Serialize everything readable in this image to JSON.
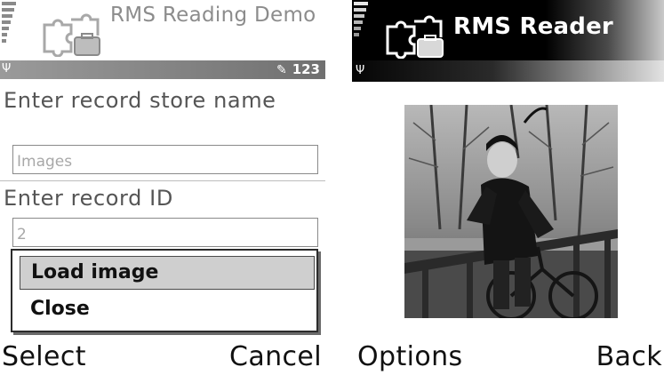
{
  "left_screen": {
    "title": "RMS Reading Demo",
    "status_mode": "123",
    "form": {
      "store_label": "Enter record store name",
      "store_value": "Images",
      "id_label": "Enter record ID",
      "id_value": "2"
    },
    "menu": {
      "items": [
        "Load image",
        "Close"
      ],
      "selected_index": 0
    },
    "softkeys": {
      "left": "Select",
      "right": "Cancel"
    }
  },
  "right_screen": {
    "title": "RMS Reader",
    "softkeys": {
      "left": "Options",
      "right": "Back"
    }
  },
  "icons": [
    "signal-strength-icon",
    "app-puzzle-icon",
    "antenna-icon",
    "pen-input-icon"
  ],
  "colors": {
    "status_bar": "#8a8a8a",
    "header_dark": "#000000",
    "menu_highlight": "#cfcfcf"
  }
}
